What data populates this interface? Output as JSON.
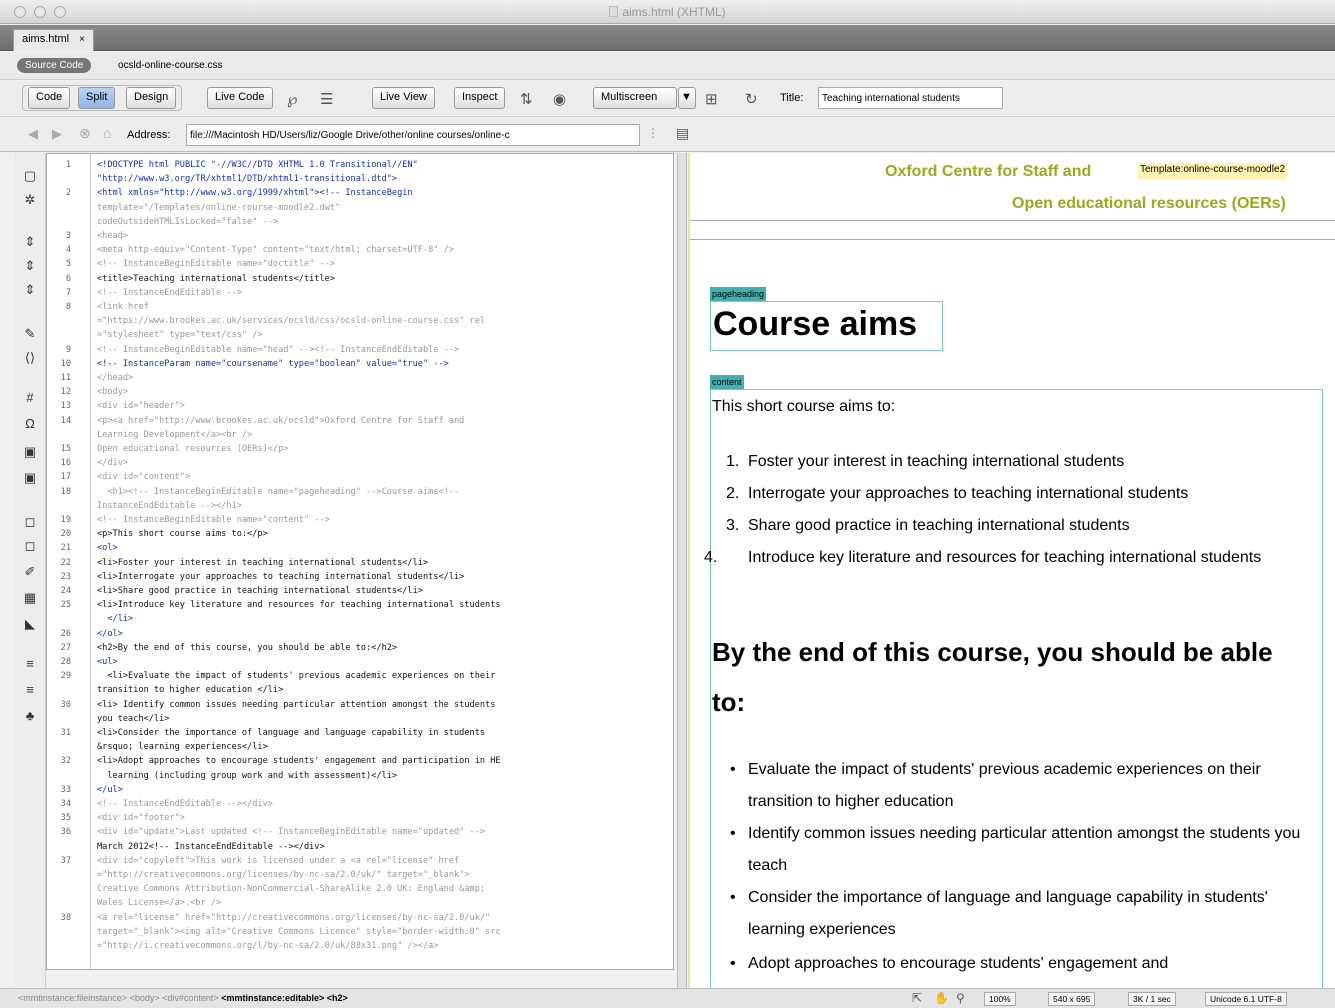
{
  "window": {
    "title": "aims.html (XHTML)"
  },
  "doc_tab": {
    "label": "aims.html",
    "close": "×"
  },
  "related": {
    "source_code": "Source Code",
    "css_file": "ocsld-online-course.css"
  },
  "toolbar": {
    "code": "Code",
    "split": "Split",
    "design": "Design",
    "live_code": "Live Code",
    "live_view": "Live View",
    "inspect": "Inspect",
    "multiscreen": "Multiscreen",
    "title_label": "Title:",
    "title_value": "Teaching international students"
  },
  "address": {
    "label": "Address:",
    "value": "file:///Macintosh HD/Users/liz/Google Drive/other/online courses/online-c"
  },
  "code_lines": [
    {
      "n": "1",
      "t": "<!DOCTYPE html PUBLIC \"-//W3C//DTD XHTML 1.0 Transitional//EN\"",
      "c": "tag"
    },
    {
      "n": "",
      "t": "\"http://www.w3.org/TR/xhtml1/DTD/xhtml1-transitional.dtd\">",
      "c": "tag"
    },
    {
      "n": "2",
      "t": "<html xmlns=\"http://www.w3.org/1999/xhtml\"><!-- InstanceBegin",
      "c": "tag"
    },
    {
      "n": "",
      "t": "template=\"/Templates/online-course-moodle2.dwt\"",
      "c": ""
    },
    {
      "n": "",
      "t": "codeOutsideHTMLIsLocked=\"false\" -->",
      "c": ""
    },
    {
      "n": "3",
      "t": "<head>",
      "c": ""
    },
    {
      "n": "4",
      "t": "<meta http-equiv=\"Content-Type\" content=\"text/html; charset=UTF-8\" />",
      "c": ""
    },
    {
      "n": "5",
      "t": "<!-- InstanceBeginEditable name=\"doctitle\" -->",
      "c": ""
    },
    {
      "n": "6",
      "t": "<title>Teaching international students</title>",
      "c": "dark"
    },
    {
      "n": "7",
      "t": "<!-- InstanceEndEditable -->",
      "c": ""
    },
    {
      "n": "8",
      "t": "<link href",
      "c": ""
    },
    {
      "n": "",
      "t": "=\"https://www.brookes.ac.uk/services/ocsld/css/ocsld-online-course.css\" rel",
      "c": ""
    },
    {
      "n": "",
      "t": "=\"stylesheet\" type=\"text/css\" />",
      "c": ""
    },
    {
      "n": "9",
      "t": "<!-- InstanceBeginEditable name=\"head\" --><!-- InstanceEndEditable -->",
      "c": ""
    },
    {
      "n": "10",
      "t": "<!-- InstanceParam name=\"coursename\" type=\"boolean\" value=\"true\" -->",
      "c": "tag"
    },
    {
      "n": "11",
      "t": "</head>",
      "c": ""
    },
    {
      "n": "12",
      "t": "<body>",
      "c": ""
    },
    {
      "n": "13",
      "t": "<div id=\"header\">",
      "c": ""
    },
    {
      "n": "14",
      "t": "<p><a href=\"http://www.brookes.ac.uk/ocsld\">Oxford Centre for Staff and",
      "c": ""
    },
    {
      "n": "",
      "t": "Learning Development</a><br />",
      "c": ""
    },
    {
      "n": "15",
      "t": "Open educational resources (OERs)</p>",
      "c": ""
    },
    {
      "n": "16",
      "t": "</div>",
      "c": ""
    },
    {
      "n": "17",
      "t": "<div id=\"content\">",
      "c": ""
    },
    {
      "n": "18",
      "t": "  <h1><!-- InstanceBeginEditable name=\"pageheading\" -->Course aims<!--",
      "c": ""
    },
    {
      "n": "",
      "t": "InstanceEndEditable --></h1>",
      "c": ""
    },
    {
      "n": "19",
      "t": "<!-- InstanceBeginEditable name=\"content\" -->",
      "c": ""
    },
    {
      "n": "20",
      "t": "<p>This short course aims to:</p>",
      "c": "dark"
    },
    {
      "n": "21",
      "t": "<ol>",
      "c": "tag"
    },
    {
      "n": "22",
      "t": "<li>Foster your interest in teaching international students</li>",
      "c": "dark"
    },
    {
      "n": "23",
      "t": "<li>Interrogate your approaches to teaching international students</li>",
      "c": "dark"
    },
    {
      "n": "24",
      "t": "<li>Share good practice in teaching international students</li>",
      "c": "dark"
    },
    {
      "n": "25",
      "t": "<li>Introduce key literature and resources for teaching international students",
      "c": "dark"
    },
    {
      "n": "",
      "t": "  </li>",
      "c": "tag"
    },
    {
      "n": "26",
      "t": "</ol>",
      "c": "tag"
    },
    {
      "n": "27",
      "t": "<h2>By the end of this course, you should be able to:</h2>",
      "c": "dark"
    },
    {
      "n": "28",
      "t": "<ul>",
      "c": "tag"
    },
    {
      "n": "29",
      "t": "  <li>Evaluate the impact of students' previous academic experiences on their",
      "c": "dark"
    },
    {
      "n": "",
      "t": "transition to higher education </li>",
      "c": "dark"
    },
    {
      "n": "30",
      "t": "<li> Identify common issues needing particular attention amongst the students",
      "c": "dark"
    },
    {
      "n": "",
      "t": "you teach</li>",
      "c": "dark"
    },
    {
      "n": "31",
      "t": "<li>Consider the importance of language and language capability in students",
      "c": "dark"
    },
    {
      "n": "",
      "t": "&rsquo; learning experiences</li>",
      "c": "dark"
    },
    {
      "n": "32",
      "t": "<li>Adopt approaches to encourage students' engagement and participation in HE",
      "c": "dark"
    },
    {
      "n": "",
      "t": "  learning (including group work and with assessment)</li>",
      "c": "dark"
    },
    {
      "n": "33",
      "t": "</ul>",
      "c": "tag"
    },
    {
      "n": "34",
      "t": "<!-- InstanceEndEditable --></div>",
      "c": ""
    },
    {
      "n": "35",
      "t": "<div id=\"footer\">",
      "c": ""
    },
    {
      "n": "36",
      "t": "<div id=\"update\">Last updated <!-- InstanceBeginEditable name=\"updated\" -->",
      "c": ""
    },
    {
      "n": "",
      "t": "March 2012<!-- InstanceEndEditable --></div>",
      "c": "dark"
    },
    {
      "n": "37",
      "t": "<div id=\"copyleft\">This work is licensed under a <a rel=\"license\" href",
      "c": ""
    },
    {
      "n": "",
      "t": "=\"http://creativecommons.org/licenses/by-nc-sa/2.0/uk/\" target=\"_blank\">",
      "c": ""
    },
    {
      "n": "",
      "t": "Creative Commons Attribution-NonCommercial-ShareAlike 2.0 UK: England &amp;",
      "c": ""
    },
    {
      "n": "",
      "t": "Wales License</a>.<br />",
      "c": ""
    },
    {
      "n": "38",
      "t": "<a rel=\"license\" href=\"http://creativecommons.org/licenses/by-nc-sa/2.0/uk/\"",
      "c": ""
    },
    {
      "n": "",
      "t": "target=\"_blank\"><img alt=\"Creative Commons Licence\" style=\"border-width:0\" src",
      "c": ""
    },
    {
      "n": "",
      "t": "=\"http://i.creativecommons.org/l/by-nc-sa/2.0/uk/88x31.png\" /></a>",
      "c": ""
    }
  ],
  "design": {
    "org_line1": "Oxford Centre for Staff and",
    "template_badge": "Template:online-course-moodle2",
    "org_line2": "Open educational resources (OERs)",
    "pageheading_badge": "pageheading",
    "heading": "Course aims",
    "content_badge": "content",
    "intro": "This short course aims to:",
    "aims": [
      {
        "num": "1.",
        "text": "Foster your interest in teaching international students"
      },
      {
        "num": "2.",
        "text": "Interrogate your approaches to teaching international students"
      },
      {
        "num": "3.",
        "text": "Share good practice in teaching international students"
      },
      {
        "num": "4.",
        "text": "Introduce key literature and resources for teaching international students"
      }
    ],
    "subheading": "By the end of this course, you should be able to:",
    "outcomes": [
      "Evaluate the impact of students' previous academic experiences on their transition to higher education",
      "Identify common issues needing particular attention amongst the students you teach",
      "Consider the importance of language and language capability in students' learning experiences",
      "Adopt approaches to encourage students' engagement and"
    ],
    "bullet": "•"
  },
  "status": {
    "crumb1": "<mmtinstance:fileinstance>",
    "crumb2": "<body>",
    "crumb3": "<div#content>",
    "crumb4": "<mmtinstance:editable>",
    "crumb5": "<h2>",
    "zoom": "100%",
    "size": "540 x 695",
    "weight": "3K / 1 sec",
    "encoding": "Unicode 6.1 UTF-8"
  }
}
